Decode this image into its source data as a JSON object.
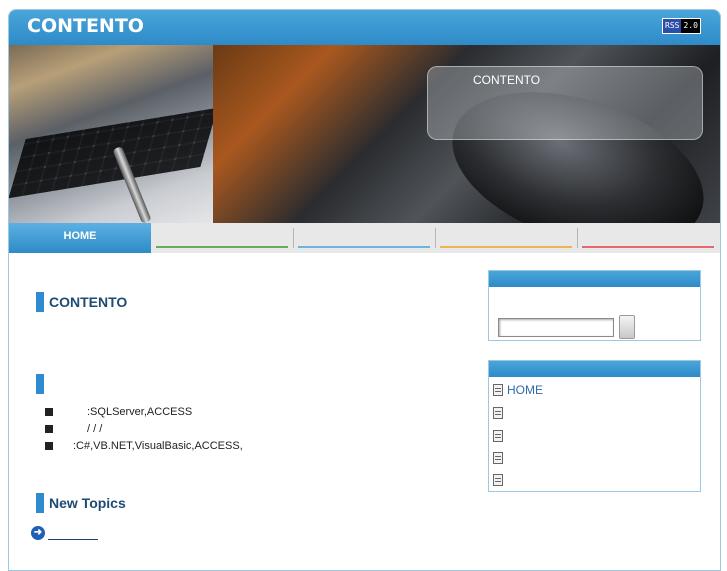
{
  "header": {
    "site_title": "CONTENTO",
    "rss_badge": {
      "left": "RSS",
      "right": "2.0"
    }
  },
  "hero": {
    "panel_title": "CONTENTO"
  },
  "nav": {
    "home_label": "HOME",
    "underline_colors": [
      "#6aaa5e",
      "#6fb2de",
      "#f0b252",
      "#e26a6a"
    ]
  },
  "main": {
    "section1_title": "CONTENTO",
    "section2_title": "",
    "bullets": [
      ":SQLServer,ACCESS",
      "/    /    /",
      ":C#,VB.NET,VisualBasic,ACCESS,"
    ],
    "section3_title": "New Topics"
  },
  "sidebar": {
    "search_value": "",
    "menu": [
      "HOME",
      "",
      "",
      "",
      ""
    ]
  },
  "colors": {
    "accent": "#2e8bc8",
    "title_text": "#1f4a73",
    "link": "#2e6aa8"
  }
}
